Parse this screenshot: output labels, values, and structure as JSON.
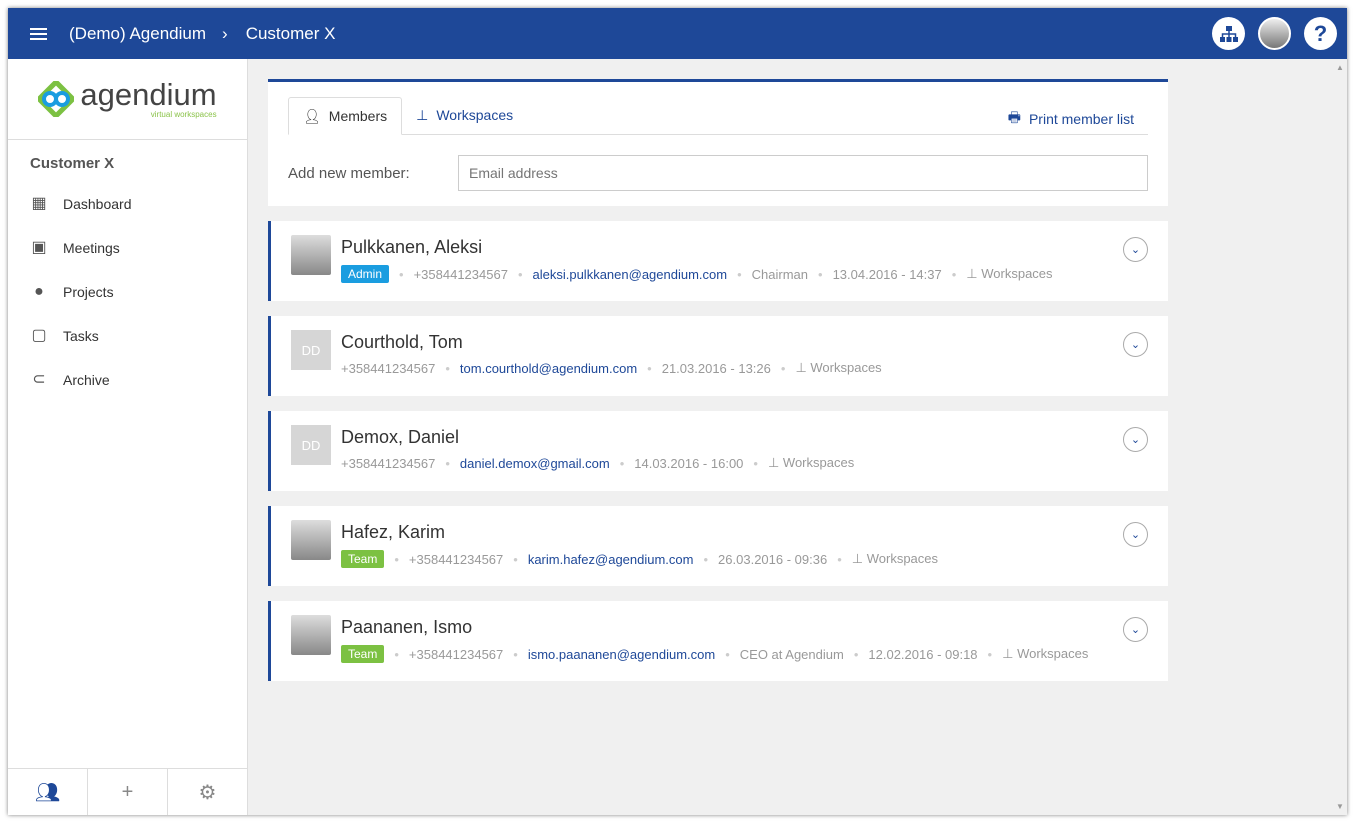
{
  "header": {
    "breadcrumb": [
      "(Demo) Agendium",
      "Customer X"
    ]
  },
  "logo": {
    "name": "agendium",
    "tagline": "virtual workspaces"
  },
  "sidebar": {
    "section": "Customer X",
    "items": [
      {
        "label": "Dashboard",
        "icon": "dashboard-icon"
      },
      {
        "label": "Meetings",
        "icon": "calendar-icon"
      },
      {
        "label": "Projects",
        "icon": "compass-icon"
      },
      {
        "label": "Tasks",
        "icon": "clipboard-icon"
      },
      {
        "label": "Archive",
        "icon": "paperclip-icon"
      }
    ]
  },
  "tabs": {
    "members": "Members",
    "workspaces": "Workspaces",
    "print": "Print member list"
  },
  "add": {
    "label": "Add new member:",
    "placeholder": "Email address"
  },
  "colors": {
    "primary": "#1e4898",
    "admin": "#1a9de0",
    "team": "#7cc142"
  },
  "members": [
    {
      "name": "Pulkkanen, Aleksi",
      "avatar": "photo",
      "badge": "Admin",
      "phone": "+358441234567",
      "email": "aleksi.pulkkanen@agendium.com",
      "title": "Chairman",
      "date": "13.04.2016 - 14:37",
      "ws": "Workspaces"
    },
    {
      "name": "Courthold, Tom",
      "avatar": "DD",
      "phone": "+358441234567",
      "email": "tom.courthold@agendium.com",
      "date": "21.03.2016 - 13:26",
      "ws": "Workspaces"
    },
    {
      "name": "Demox, Daniel",
      "avatar": "DD",
      "phone": "+358441234567",
      "email": "daniel.demox@gmail.com",
      "date": "14.03.2016 - 16:00",
      "ws": "Workspaces"
    },
    {
      "name": "Hafez, Karim",
      "avatar": "photo",
      "badge": "Team",
      "phone": "+358441234567",
      "email": "karim.hafez@agendium.com",
      "date": "26.03.2016 - 09:36",
      "ws": "Workspaces"
    },
    {
      "name": "Paananen, Ismo",
      "avatar": "photo",
      "badge": "Team",
      "phone": "+358441234567",
      "email": "ismo.paananen@agendium.com",
      "title": "CEO at Agendium",
      "date": "12.02.2016 - 09:18",
      "ws": "Workspaces"
    }
  ]
}
